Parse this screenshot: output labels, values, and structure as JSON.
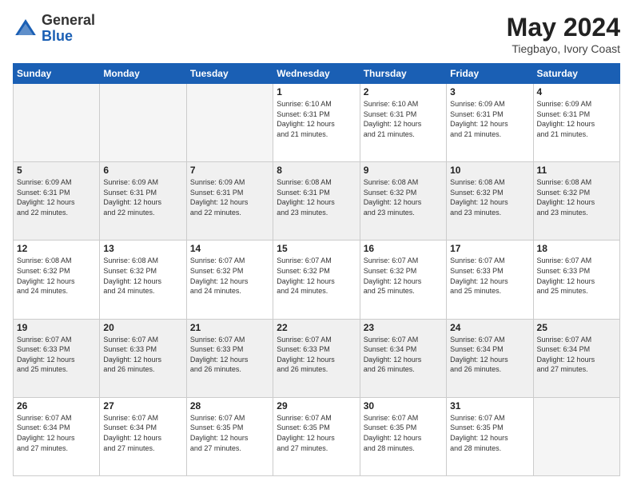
{
  "header": {
    "logo_general": "General",
    "logo_blue": "Blue",
    "month_year": "May 2024",
    "location": "Tiegbayo, Ivory Coast"
  },
  "weekdays": [
    "Sunday",
    "Monday",
    "Tuesday",
    "Wednesday",
    "Thursday",
    "Friday",
    "Saturday"
  ],
  "weeks": [
    {
      "shaded": false,
      "days": [
        {
          "num": "",
          "info": "",
          "empty": true
        },
        {
          "num": "",
          "info": "",
          "empty": true
        },
        {
          "num": "",
          "info": "",
          "empty": true
        },
        {
          "num": "1",
          "info": "Sunrise: 6:10 AM\nSunset: 6:31 PM\nDaylight: 12 hours\nand 21 minutes.",
          "empty": false
        },
        {
          "num": "2",
          "info": "Sunrise: 6:10 AM\nSunset: 6:31 PM\nDaylight: 12 hours\nand 21 minutes.",
          "empty": false
        },
        {
          "num": "3",
          "info": "Sunrise: 6:09 AM\nSunset: 6:31 PM\nDaylight: 12 hours\nand 21 minutes.",
          "empty": false
        },
        {
          "num": "4",
          "info": "Sunrise: 6:09 AM\nSunset: 6:31 PM\nDaylight: 12 hours\nand 21 minutes.",
          "empty": false
        }
      ]
    },
    {
      "shaded": true,
      "days": [
        {
          "num": "5",
          "info": "Sunrise: 6:09 AM\nSunset: 6:31 PM\nDaylight: 12 hours\nand 22 minutes.",
          "empty": false
        },
        {
          "num": "6",
          "info": "Sunrise: 6:09 AM\nSunset: 6:31 PM\nDaylight: 12 hours\nand 22 minutes.",
          "empty": false
        },
        {
          "num": "7",
          "info": "Sunrise: 6:09 AM\nSunset: 6:31 PM\nDaylight: 12 hours\nand 22 minutes.",
          "empty": false
        },
        {
          "num": "8",
          "info": "Sunrise: 6:08 AM\nSunset: 6:31 PM\nDaylight: 12 hours\nand 23 minutes.",
          "empty": false
        },
        {
          "num": "9",
          "info": "Sunrise: 6:08 AM\nSunset: 6:32 PM\nDaylight: 12 hours\nand 23 minutes.",
          "empty": false
        },
        {
          "num": "10",
          "info": "Sunrise: 6:08 AM\nSunset: 6:32 PM\nDaylight: 12 hours\nand 23 minutes.",
          "empty": false
        },
        {
          "num": "11",
          "info": "Sunrise: 6:08 AM\nSunset: 6:32 PM\nDaylight: 12 hours\nand 23 minutes.",
          "empty": false
        }
      ]
    },
    {
      "shaded": false,
      "days": [
        {
          "num": "12",
          "info": "Sunrise: 6:08 AM\nSunset: 6:32 PM\nDaylight: 12 hours\nand 24 minutes.",
          "empty": false
        },
        {
          "num": "13",
          "info": "Sunrise: 6:08 AM\nSunset: 6:32 PM\nDaylight: 12 hours\nand 24 minutes.",
          "empty": false
        },
        {
          "num": "14",
          "info": "Sunrise: 6:07 AM\nSunset: 6:32 PM\nDaylight: 12 hours\nand 24 minutes.",
          "empty": false
        },
        {
          "num": "15",
          "info": "Sunrise: 6:07 AM\nSunset: 6:32 PM\nDaylight: 12 hours\nand 24 minutes.",
          "empty": false
        },
        {
          "num": "16",
          "info": "Sunrise: 6:07 AM\nSunset: 6:32 PM\nDaylight: 12 hours\nand 25 minutes.",
          "empty": false
        },
        {
          "num": "17",
          "info": "Sunrise: 6:07 AM\nSunset: 6:33 PM\nDaylight: 12 hours\nand 25 minutes.",
          "empty": false
        },
        {
          "num": "18",
          "info": "Sunrise: 6:07 AM\nSunset: 6:33 PM\nDaylight: 12 hours\nand 25 minutes.",
          "empty": false
        }
      ]
    },
    {
      "shaded": true,
      "days": [
        {
          "num": "19",
          "info": "Sunrise: 6:07 AM\nSunset: 6:33 PM\nDaylight: 12 hours\nand 25 minutes.",
          "empty": false
        },
        {
          "num": "20",
          "info": "Sunrise: 6:07 AM\nSunset: 6:33 PM\nDaylight: 12 hours\nand 26 minutes.",
          "empty": false
        },
        {
          "num": "21",
          "info": "Sunrise: 6:07 AM\nSunset: 6:33 PM\nDaylight: 12 hours\nand 26 minutes.",
          "empty": false
        },
        {
          "num": "22",
          "info": "Sunrise: 6:07 AM\nSunset: 6:33 PM\nDaylight: 12 hours\nand 26 minutes.",
          "empty": false
        },
        {
          "num": "23",
          "info": "Sunrise: 6:07 AM\nSunset: 6:34 PM\nDaylight: 12 hours\nand 26 minutes.",
          "empty": false
        },
        {
          "num": "24",
          "info": "Sunrise: 6:07 AM\nSunset: 6:34 PM\nDaylight: 12 hours\nand 26 minutes.",
          "empty": false
        },
        {
          "num": "25",
          "info": "Sunrise: 6:07 AM\nSunset: 6:34 PM\nDaylight: 12 hours\nand 27 minutes.",
          "empty": false
        }
      ]
    },
    {
      "shaded": false,
      "days": [
        {
          "num": "26",
          "info": "Sunrise: 6:07 AM\nSunset: 6:34 PM\nDaylight: 12 hours\nand 27 minutes.",
          "empty": false
        },
        {
          "num": "27",
          "info": "Sunrise: 6:07 AM\nSunset: 6:34 PM\nDaylight: 12 hours\nand 27 minutes.",
          "empty": false
        },
        {
          "num": "28",
          "info": "Sunrise: 6:07 AM\nSunset: 6:35 PM\nDaylight: 12 hours\nand 27 minutes.",
          "empty": false
        },
        {
          "num": "29",
          "info": "Sunrise: 6:07 AM\nSunset: 6:35 PM\nDaylight: 12 hours\nand 27 minutes.",
          "empty": false
        },
        {
          "num": "30",
          "info": "Sunrise: 6:07 AM\nSunset: 6:35 PM\nDaylight: 12 hours\nand 28 minutes.",
          "empty": false
        },
        {
          "num": "31",
          "info": "Sunrise: 6:07 AM\nSunset: 6:35 PM\nDaylight: 12 hours\nand 28 minutes.",
          "empty": false
        },
        {
          "num": "",
          "info": "",
          "empty": true
        }
      ]
    }
  ]
}
